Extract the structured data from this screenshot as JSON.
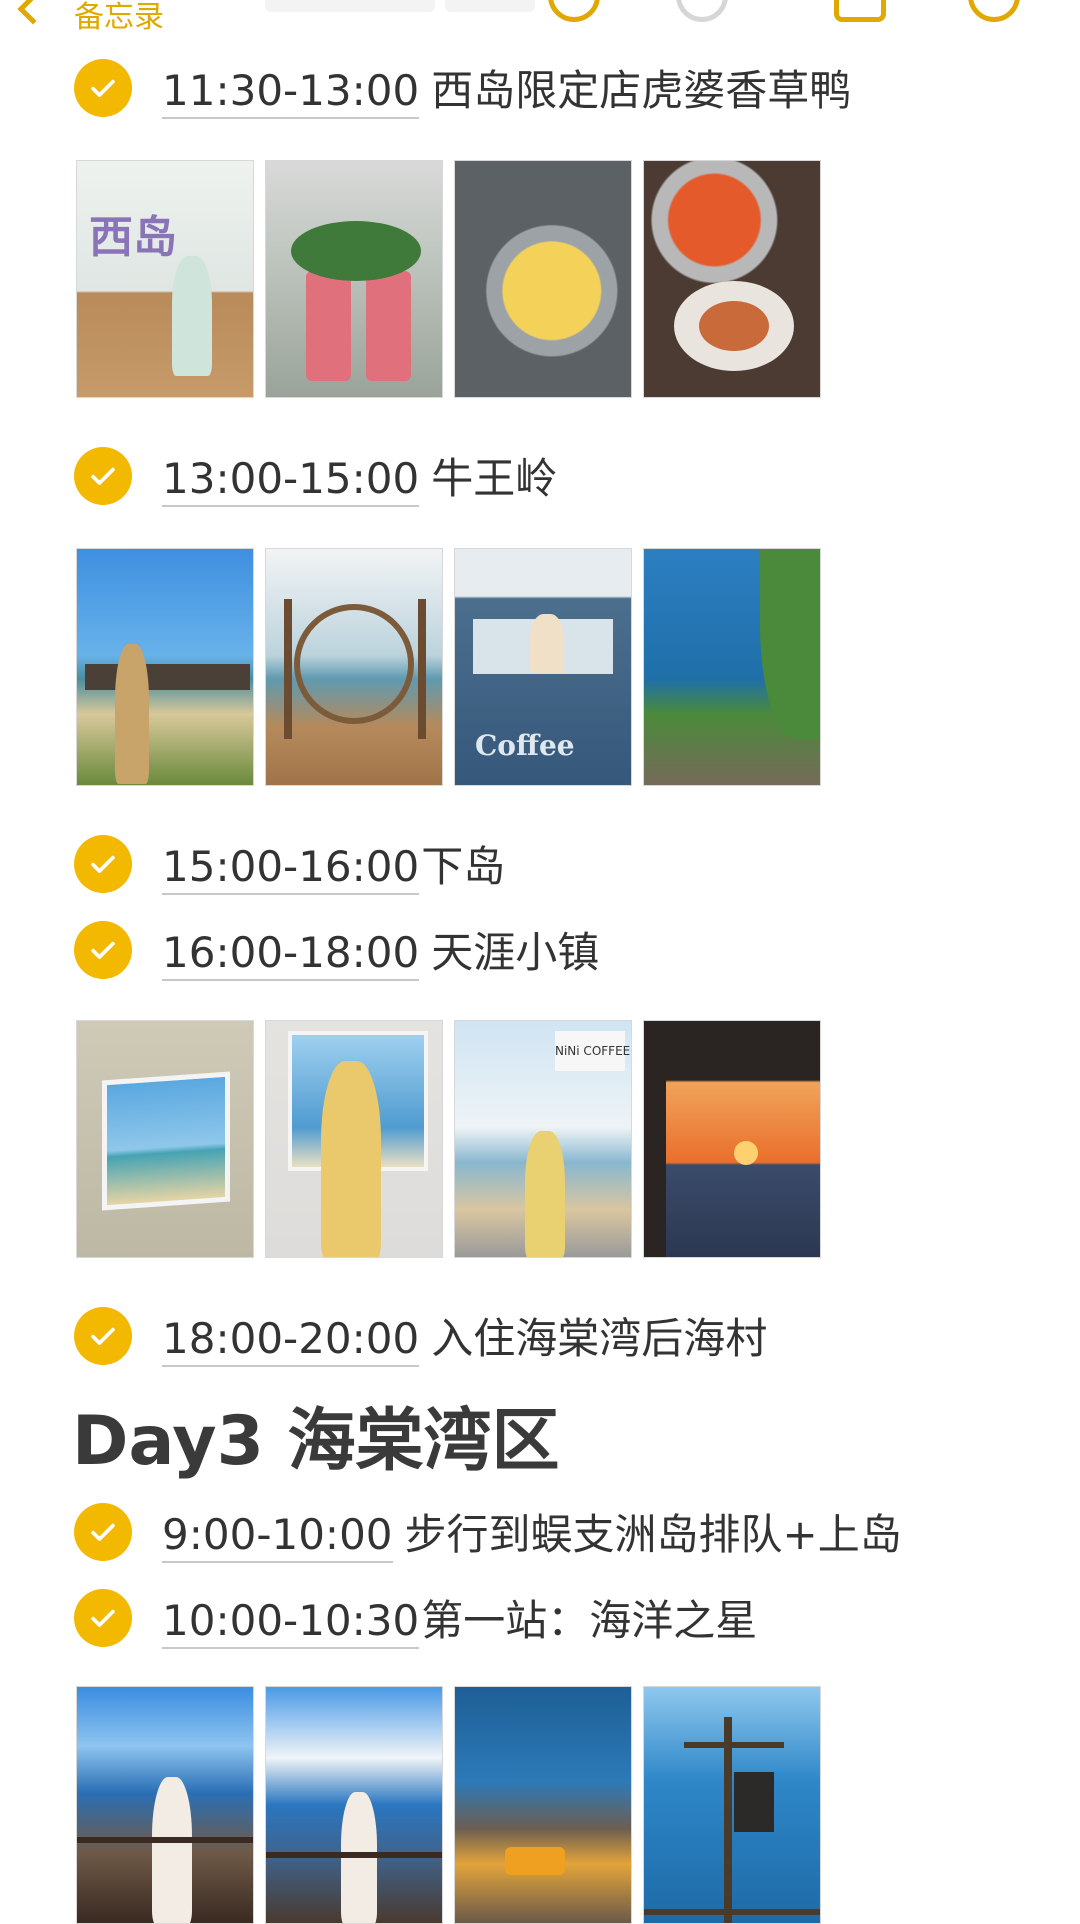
{
  "header": {
    "back_label": "备忘录",
    "icons": [
      "undo-icon",
      "redo-icon",
      "share-icon",
      "more-icon"
    ]
  },
  "items": [
    {
      "time": "11:30-13:00",
      "title": "西岛限定店虎婆香草鸭",
      "checked": true
    },
    {
      "time": "13:00-15:00",
      "title": "牛王岭",
      "checked": true
    },
    {
      "time": "15:00-16:00",
      "title": "下岛",
      "checked": true
    },
    {
      "time": "16:00-18:00",
      "title": "天涯小镇",
      "checked": true
    },
    {
      "time": "18:00-20:00",
      "title": "入住海棠湾后海村",
      "checked": true
    },
    {
      "time": "9:00-10:00",
      "title": "步行到蜈支洲岛排队+上岛",
      "checked": true
    },
    {
      "time": "10:00-10:30",
      "title": "第一站：海洋之星",
      "checked": true
    }
  ],
  "day_heading": "Day3 海棠湾区",
  "photo_rows": [
    [
      "photo-west-island-sign",
      "photo-drinks",
      "photo-custard-pot",
      "photo-hotpot"
    ],
    [
      "photo-beach-sign",
      "photo-arch-swing",
      "photo-coffee-truck",
      "photo-sea-cliff"
    ],
    [
      "photo-painting-frame",
      "photo-girl-coffee",
      "photo-cafe-window",
      "photo-sunset"
    ],
    [
      "photo-rocky-coast",
      "photo-ocean-cloud",
      "photo-rock-beach",
      "photo-signpost"
    ]
  ],
  "photo_texts": {
    "sign": "西岛",
    "coffee": "Coffee",
    "cafe": "NiNi COFFEE"
  },
  "colors": {
    "accent": "#f2b900",
    "text": "#333333"
  }
}
